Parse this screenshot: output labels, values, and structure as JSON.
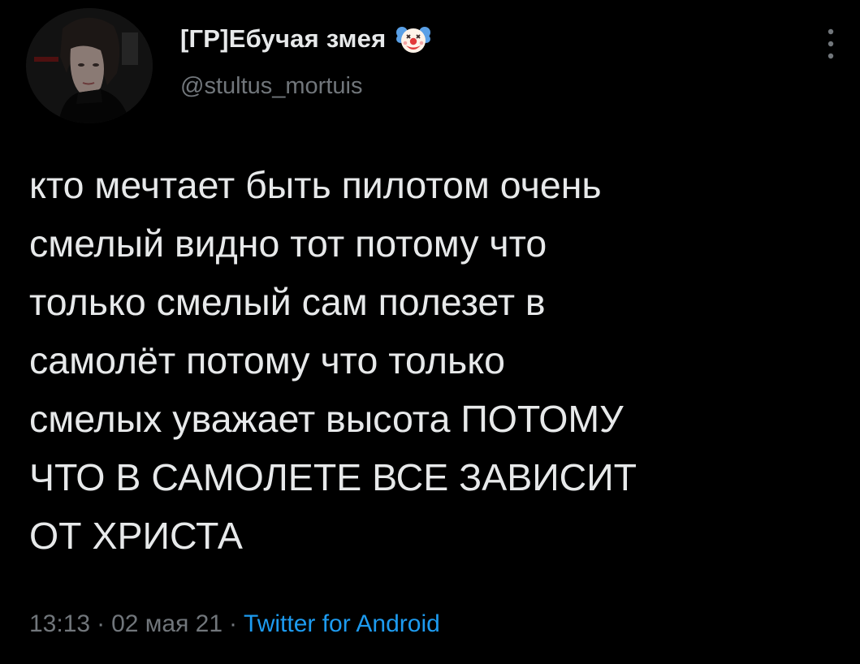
{
  "user": {
    "display_name": "[ГР]Ебучая змея",
    "display_name_icon": "clown-face-icon",
    "handle": "@stultus_mortuis"
  },
  "tweet": {
    "lines": [
      "кто мечтает быть пилотом очень",
      "смелый видно тот потому что",
      "только смелый сам полезет в",
      "самолёт потому что только",
      "смелых уважает высота ПОТОМУ",
      "ЧТО В САМОЛЕТЕ ВСЕ ЗАВИСИТ",
      "ОТ ХРИСТА"
    ]
  },
  "meta": {
    "time": "13:13",
    "separator": "·",
    "date": "02 мая 21",
    "source": "Twitter for Android"
  },
  "icons": {
    "more": "more-vertical-icon"
  },
  "colors": {
    "background": "#000000",
    "text_primary": "#e7e9ea",
    "text_secondary": "#71767b",
    "link": "#1d9bf0"
  }
}
